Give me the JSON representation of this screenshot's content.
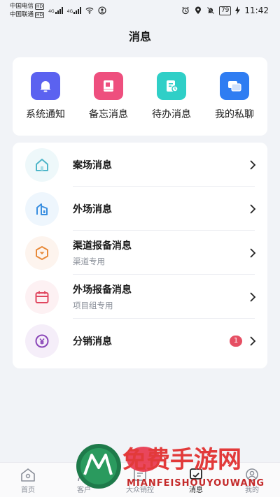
{
  "status_bar": {
    "carrier1": "中国电信",
    "carrier2": "中国联通",
    "hd": "HD",
    "net1": "4G",
    "net2": "4G",
    "battery": "79",
    "time": "11:42"
  },
  "page": {
    "title": "消息"
  },
  "quick_actions": [
    {
      "label": "系统通知",
      "icon": "bell-icon",
      "color": "#5b62f0"
    },
    {
      "label": "备忘消息",
      "icon": "memo-book-icon",
      "color": "#ee4f7e"
    },
    {
      "label": "待办消息",
      "icon": "todo-clipboard-icon",
      "color": "#2fcfc7"
    },
    {
      "label": "我的私聊",
      "icon": "chat-bubbles-icon",
      "color": "#2f7df2"
    }
  ],
  "message_list": [
    {
      "title": "案场消息",
      "subtitle": "",
      "icon": "home-icon",
      "icon_color": "#4fb6c9",
      "bg": "#eef8fa",
      "badge": ""
    },
    {
      "title": "外场消息",
      "subtitle": "",
      "icon": "building-icon",
      "icon_color": "#3a8fe0",
      "bg": "#eef6fd",
      "badge": ""
    },
    {
      "title": "渠道报备消息",
      "subtitle": "渠道专用",
      "icon": "hexagon-down-icon",
      "icon_color": "#e88a3a",
      "bg": "#fdf4ee",
      "badge": ""
    },
    {
      "title": "外场报备消息",
      "subtitle": "项目组专用",
      "icon": "calendar-icon",
      "icon_color": "#e0465f",
      "bg": "#fdf1f3",
      "badge": ""
    },
    {
      "title": "分销消息",
      "subtitle": "",
      "icon": "yen-coin-icon",
      "icon_color": "#8a46b8",
      "bg": "#f5eef9",
      "badge": "1"
    }
  ],
  "bottom_nav": [
    {
      "label": "首页",
      "icon": "home-outline-icon",
      "active": false
    },
    {
      "label": "客户",
      "icon": "customer-icon",
      "active": false
    },
    {
      "label": "大众销控",
      "icon": "sales-control-icon",
      "active": false
    },
    {
      "label": "消息",
      "icon": "message-icon",
      "active": true
    },
    {
      "label": "我的",
      "icon": "profile-icon",
      "active": false
    }
  ],
  "watermark": {
    "cn": "免费手游网",
    "en": "MIANFEISHOUYOUWANG"
  }
}
